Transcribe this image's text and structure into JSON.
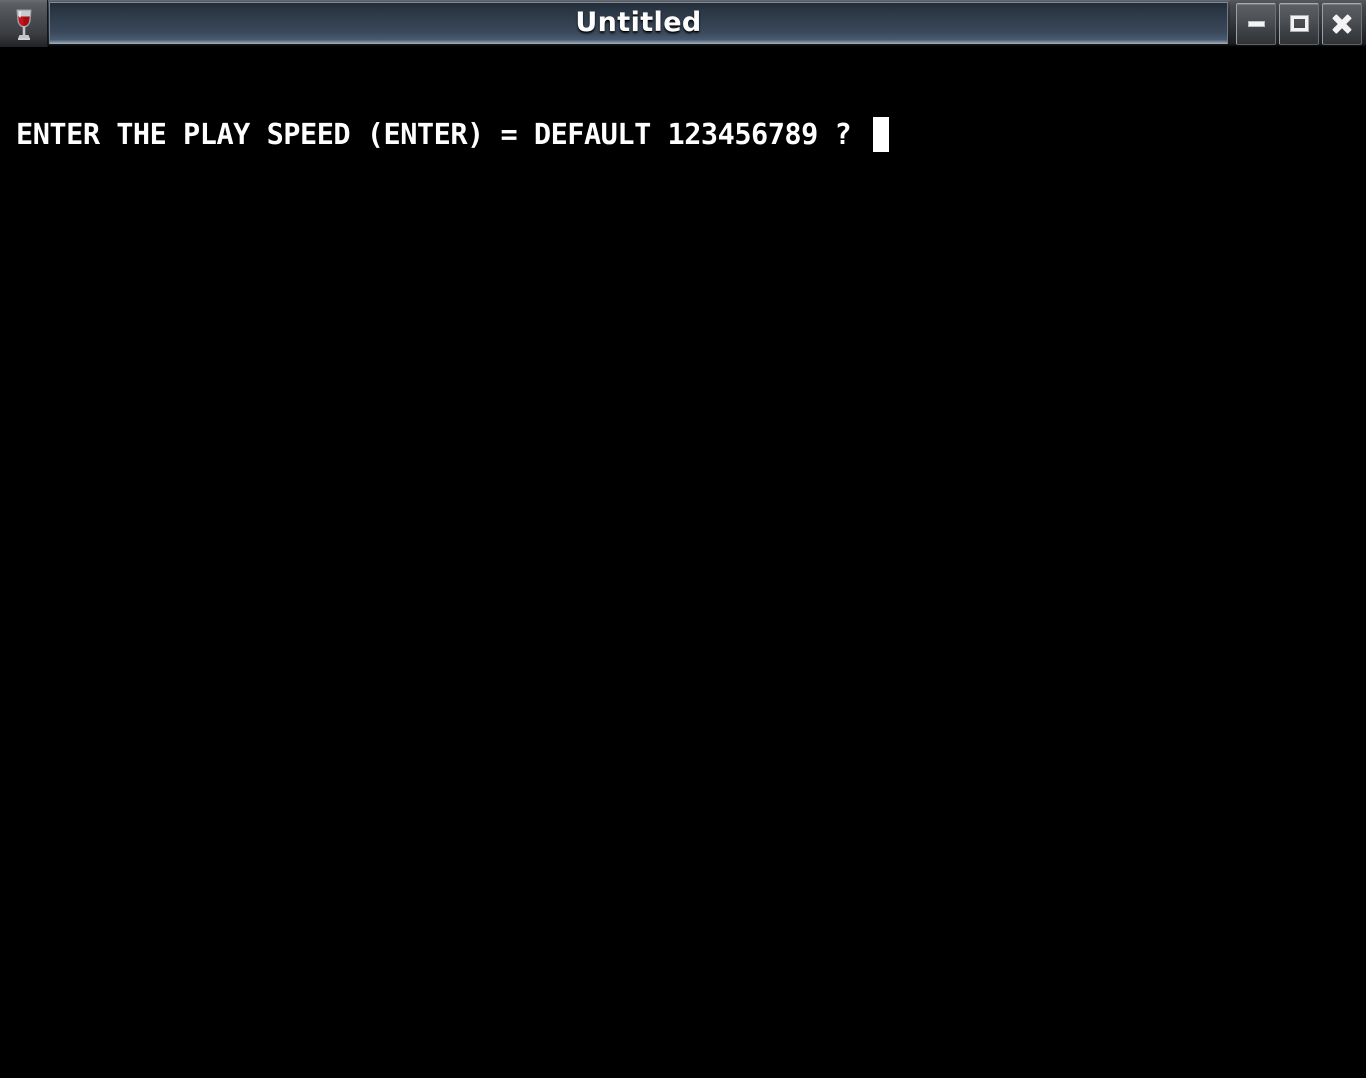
{
  "window": {
    "title": "Untitled",
    "app_icon": "wine-glass-icon",
    "background_color": "#000000",
    "titlebar_accent": "#39485a"
  },
  "caption_buttons": [
    {
      "name": "minimize",
      "label": "–",
      "icon": "minimize-icon"
    },
    {
      "name": "maximize",
      "label": "□",
      "icon": "maximize-icon"
    },
    {
      "name": "close",
      "label": "✕",
      "icon": "close-icon"
    }
  ],
  "console": {
    "prompt_line": "ENTER THE PLAY SPEED (ENTER) = DEFAULT 123456789 ?",
    "cursor": "block",
    "cursor_visible": true,
    "text_color": "#ffffff",
    "background_color": "#000000"
  }
}
